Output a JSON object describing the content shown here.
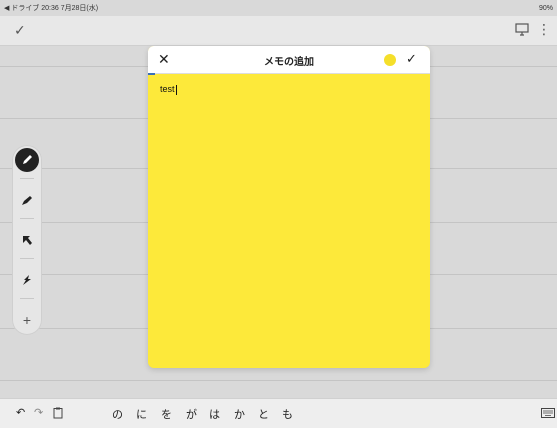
{
  "status_bar": {
    "left": "◀ ドライブ 20:36  7月28日(水)",
    "right": "90%"
  },
  "toolbar": {
    "done_icon": "check-icon",
    "present_icon": "present-icon",
    "more_icon": "more-icon"
  },
  "dialog": {
    "close_icon": "close-icon",
    "title": "メモの追加",
    "color": "#f5df2a",
    "confirm_icon": "check-icon",
    "text": "test",
    "background": "#fde93a"
  },
  "left_tools": [
    {
      "name": "pen-tool",
      "icon": "pen-icon",
      "active": true
    },
    {
      "name": "highlighter-tool",
      "icon": "marker-icon",
      "active": false
    },
    {
      "name": "select-tool",
      "icon": "arrow-icon",
      "active": false
    },
    {
      "name": "laser-tool",
      "icon": "laser-icon",
      "active": false
    },
    {
      "name": "add-tool",
      "icon": "plus-icon",
      "label": "+",
      "active": false
    }
  ],
  "keyboard_bar": {
    "undo": "↶",
    "redo": "↷",
    "suggestions": [
      "の",
      "に",
      "を",
      "が",
      "は",
      "か",
      "と",
      "も"
    ]
  }
}
